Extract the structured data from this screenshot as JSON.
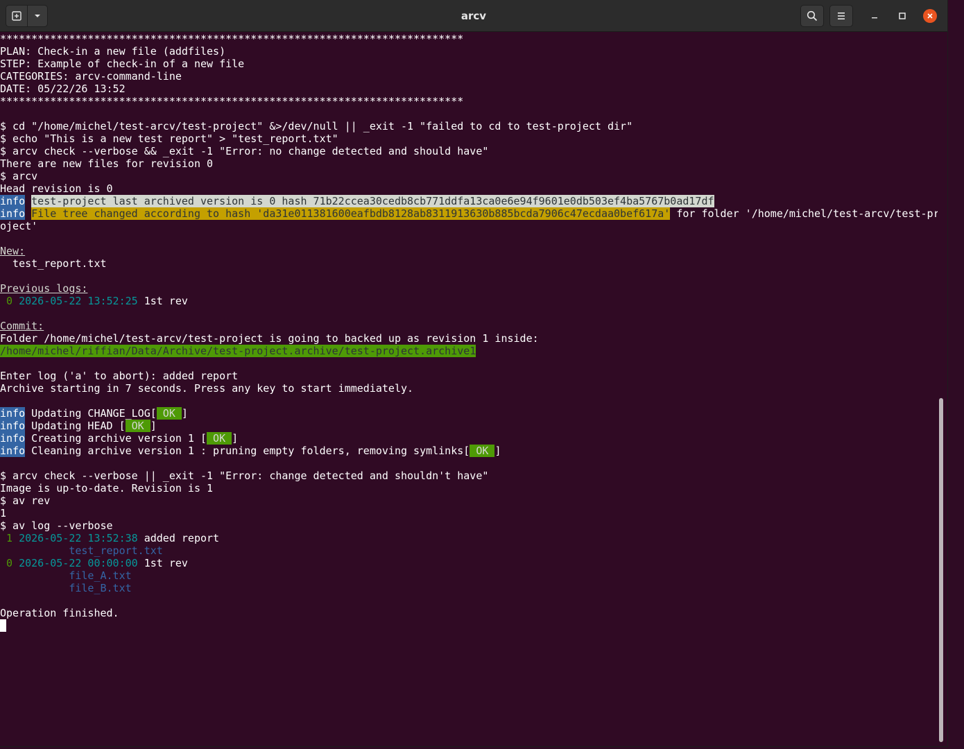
{
  "window": {
    "title": "arcv"
  },
  "icons": {
    "new_tab": "new-tab-icon",
    "dropdown": "chevron-down-icon",
    "search": "search-icon",
    "menu": "hamburger-menu-icon",
    "minimize": "minimize-icon",
    "maximize": "maximize-icon",
    "close": "close-icon"
  },
  "colors": {
    "terminal_bg": "#300a24",
    "info_bg": "#3465a4",
    "ok_bg": "#4e9a06",
    "highlight_yellow": "#c4a000",
    "highlight_grey": "#d3d7cf",
    "date_cyan": "#06989a",
    "close_orange": "#e95420"
  },
  "terminal": {
    "lines": [
      [
        {
          "t": "**************************************************************************"
        }
      ],
      [
        {
          "t": "PLAN: Check-in a new file (addfiles)"
        }
      ],
      [
        {
          "t": "STEP: Example of check-in of a new file"
        }
      ],
      [
        {
          "t": "CATEGORIES: arcv-command-line"
        }
      ],
      [
        {
          "t": "DATE: 05/22/26 13:52"
        }
      ],
      [
        {
          "t": "**************************************************************************"
        }
      ],
      [],
      [
        {
          "t": "$ cd \"/home/michel/test-arcv/test-project\" &>/dev/null || _exit -1 \"failed to cd to test-project dir\""
        }
      ],
      [
        {
          "t": "$ echo \"This is a new test report\" > \"test_report.txt\""
        }
      ],
      [
        {
          "t": "$ arcv check --verbose && _exit -1 \"Error: no change detected and should have\""
        }
      ],
      [
        {
          "t": "There are new files for revision 0"
        }
      ],
      [
        {
          "t": "$ arcv"
        }
      ],
      [
        {
          "t": "Head revision is 0"
        }
      ],
      [
        {
          "t": "info",
          "c": "info"
        },
        {
          "t": " "
        },
        {
          "t": "test-project last archived version is 0 hash 71b22ccea30cedb8cb771ddfa13ca0e6e94f9601e0db503ef4ba5767b0ad17df",
          "c": "hl-grey"
        }
      ],
      [
        {
          "t": "info",
          "c": "info"
        },
        {
          "t": " "
        },
        {
          "t": "File tree changed according to hash 'da31e011381600eafbdb8128ab8311913630b885bcda7906c47ecdaa0bef617a'",
          "c": "hl-yellow"
        },
        {
          "t": " for folder '/home/michel/test-arcv/test-pr"
        }
      ],
      [
        {
          "t": "oject'"
        }
      ],
      [],
      [
        {
          "t": "New:",
          "c": "u"
        }
      ],
      [
        {
          "t": "  test_report.txt"
        }
      ],
      [],
      [
        {
          "t": "Previous logs:",
          "c": "u"
        }
      ],
      [
        {
          "t": " "
        },
        {
          "t": "0",
          "c": "num-g"
        },
        {
          "t": " "
        },
        {
          "t": "2026-05-22 13:52:25",
          "c": "date"
        },
        {
          "t": " 1st rev"
        }
      ],
      [],
      [
        {
          "t": "Commit:",
          "c": "u"
        }
      ],
      [
        {
          "t": "Folder /home/michel/test-arcv/test-project is going to backed up as revision 1 inside:"
        }
      ],
      [
        {
          "t": "/home/michel/riffian/Data/Archive/test-project.archive/test-project.archive1",
          "c": "hl-green"
        }
      ],
      [],
      [
        {
          "t": "Enter log ('a' to abort): added report"
        }
      ],
      [
        {
          "t": "Archive starting in 7 seconds. Press any key to start immediately."
        }
      ],
      [],
      [
        {
          "t": "info",
          "c": "info"
        },
        {
          "t": " Updating CHANGE_LOG["
        },
        {
          "t": " OK ",
          "c": "ok"
        },
        {
          "t": "]"
        }
      ],
      [
        {
          "t": "info",
          "c": "info"
        },
        {
          "t": " Updating HEAD ["
        },
        {
          "t": " OK ",
          "c": "ok"
        },
        {
          "t": "]"
        }
      ],
      [
        {
          "t": "info",
          "c": "info"
        },
        {
          "t": " Creating archive version 1 ["
        },
        {
          "t": " OK ",
          "c": "ok"
        },
        {
          "t": "]"
        }
      ],
      [
        {
          "t": "info",
          "c": "info"
        },
        {
          "t": " Cleaning archive version 1 : pruning empty folders, removing symlinks["
        },
        {
          "t": " OK ",
          "c": "ok"
        },
        {
          "t": "]"
        }
      ],
      [],
      [
        {
          "t": "$ arcv check --verbose || _exit -1 \"Error: change detected and shouldn't have\""
        }
      ],
      [
        {
          "t": "Image is up-to-date. Revision is 1"
        }
      ],
      [
        {
          "t": "$ av rev"
        }
      ],
      [
        {
          "t": "1"
        }
      ],
      [
        {
          "t": "$ av log --verbose"
        }
      ],
      [
        {
          "t": " "
        },
        {
          "t": "1",
          "c": "num-g"
        },
        {
          "t": " "
        },
        {
          "t": "2026-05-22 13:52:38",
          "c": "date"
        },
        {
          "t": " added report"
        }
      ],
      [
        {
          "t": "           "
        },
        {
          "t": "test_report.txt",
          "c": "file"
        }
      ],
      [
        {
          "t": " "
        },
        {
          "t": "0",
          "c": "num-g"
        },
        {
          "t": " "
        },
        {
          "t": "2026-05-22 00:00:00",
          "c": "date"
        },
        {
          "t": " 1st rev"
        }
      ],
      [
        {
          "t": "           "
        },
        {
          "t": "file_A.txt",
          "c": "file"
        }
      ],
      [
        {
          "t": "           "
        },
        {
          "t": "file_B.txt",
          "c": "file"
        }
      ],
      [],
      [
        {
          "t": "Operation finished."
        }
      ]
    ]
  }
}
